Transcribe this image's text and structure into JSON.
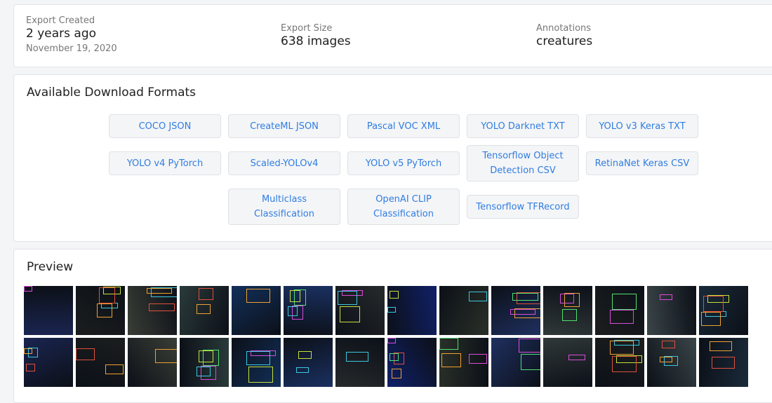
{
  "info": {
    "export_created": {
      "label": "Export Created",
      "value": "2 years ago",
      "date": "November 19, 2020"
    },
    "export_size": {
      "label": "Export Size",
      "value": "638 images"
    },
    "annotations": {
      "label": "Annotations",
      "value": "creatures"
    }
  },
  "formats": {
    "title": "Available Download Formats",
    "buttons": [
      "COCO JSON",
      "CreateML JSON",
      "Pascal VOC XML",
      "YOLO Darknet TXT",
      "YOLO v3 Keras TXT",
      "YOLO v4 PyTorch",
      "Scaled-YOLOv4",
      "YOLO v5 PyTorch",
      "Tensorflow Object Detection CSV",
      "RetinaNet Keras CSV",
      "Multiclass Classification",
      "OpenAI CLIP Classification",
      "Tensorflow TFRecord"
    ]
  },
  "preview": {
    "title": "Preview",
    "thumbnail_count": 28,
    "box_colors": [
      "#d94cd9",
      "#c8e03c",
      "#3cc8e0",
      "#e0503c",
      "#f0a030",
      "#50e070"
    ],
    "bg_colors": [
      "#1a2550",
      "#2a3a3a",
      "#262a2c",
      "#1f3060",
      "#3a4548",
      "#1a1e1e",
      "#12305a",
      "#102068",
      "#303838",
      "#1a2a3a",
      "#3a3e36",
      "#1a3060",
      "#2a3028",
      "#1c1e1e"
    ]
  }
}
